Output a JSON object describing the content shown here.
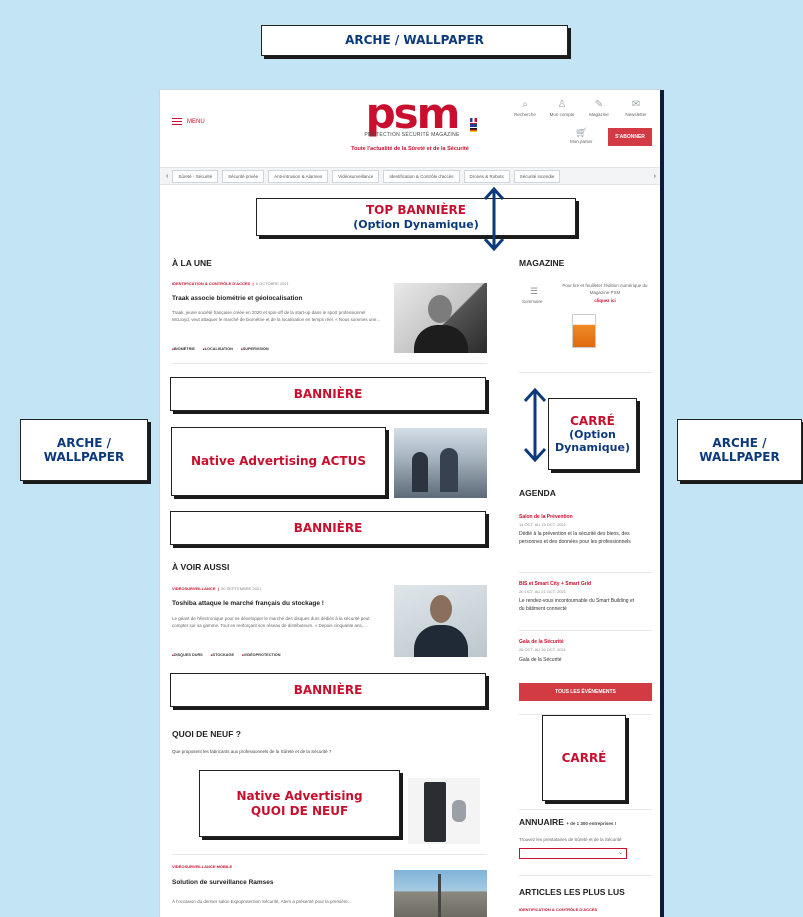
{
  "callouts": {
    "wallpaper_top": "ARCHE / WALLPAPER",
    "wallpaper_left": [
      "ARCHE /",
      "WALLPAPER"
    ],
    "wallpaper_right": [
      "ARCHE /",
      "WALLPAPER"
    ],
    "top_banner": [
      "TOP BANNIÈRE",
      "(Option Dynamique)"
    ],
    "banniere": "BANNIÈRE",
    "native_actus": "Native Advertising ACTUS",
    "native_quoi": [
      "Native Advertising",
      "QUOI DE NEUF"
    ],
    "carre_dyn": [
      "CARRÉ",
      "(Option",
      "Dynamique)"
    ],
    "carre": "CARRÉ"
  },
  "header": {
    "menu_label": "MENU",
    "logo": "psm",
    "logo_sub": "PROTECTION SÉCURITÉ MAGAZINE",
    "tagline": "Toute l'actualité de la Sûreté et de la Sécurité",
    "icons": [
      {
        "icon": "search-icon",
        "glyph": "⌕",
        "label": "Recherche"
      },
      {
        "icon": "user-icon",
        "glyph": "♙",
        "label": "Mon compte"
      },
      {
        "icon": "magazine-icon",
        "glyph": "✎",
        "label": "Magazine"
      },
      {
        "icon": "newsletter-icon",
        "glyph": "✉",
        "label": "Newsletter"
      }
    ],
    "cart_label": "Mon panier",
    "subscribe_label": "S'ABONNER"
  },
  "tabs": [
    "Sûreté - Sécurité",
    "Sécurité privée",
    "Anti-intrusion & Alarmes",
    "Vidéosurveillance",
    "Identification & Contrôle d'accès",
    "Drones & Robots",
    "Sécurité incendie"
  ],
  "a_la_une": {
    "title": "À LA UNE",
    "category": "IDENTIFICATION & CONTRÔLE D'ACCÈS",
    "date": "6 OCTOBRE 2021",
    "headline": "Traak associe biométrie et géolocalisation",
    "excerpt": "Traak, jeune société française créée en 2020 et spin-off de la start-up dans le sport professionnel McLloyd, veut attaquer le marché de biométrie et de la localisation en temps réel. « Nous sommes une...",
    "tags": [
      "BIOMÉTRIE",
      "LOCALISATION",
      "SUPERVISION"
    ]
  },
  "a_voir": {
    "title": "À VOIR AUSSI",
    "category": "VIDÉOSURVEILLANCE",
    "date": "30 SEPTEMBRE 2021",
    "headline": "Toshiba attaque le marché français du stockage !",
    "excerpt": "Le géant de l'électronique pour se développer le marché des disques durs dédiés à la sécurité peut compter sur sa gamme. Tout en renforçant son réseau de distributeurs. « Depuis cinquante ans,...",
    "tags": [
      "DISQUES DURS",
      "STOCKAGE",
      "VIDÉOPROTECTION"
    ]
  },
  "quoi_de_neuf": {
    "title": "QUOI DE NEUF ?",
    "subtitle": "Que proposent les fabricants aux professionnels de la Sûreté et de la Sécurité ?",
    "category": "VIDÉOSURVEILLANCE MOBILE",
    "headline": "Solution de surveillance Ramses",
    "excerpt": "À l'occasion du dernier salon Expoprotection Sécurité, Atem a présenté pour la première..."
  },
  "sidebar": {
    "magazine_title": "MAGAZINE",
    "magazine_text": "Pour lire et feuilleter l'édition numérique du Magazine PSM",
    "magazine_link": "cliquez ici",
    "sommaire": "Sommaire",
    "agenda_title": "AGENDA",
    "events": [
      {
        "name": "Salon de la Prévention",
        "date": "14 OCT. AU 15 OCT. 2021",
        "desc": "Dédié à la prévention et la sécurité des biens, des personnes et des données pour les professionnels"
      },
      {
        "name": "BIS et Smart City + Smart Grid",
        "date": "20 OCT. AU 21 OCT. 2021",
        "desc": "Le rendez-vous incontournable du Smart Building et du bâtiment connecté"
      },
      {
        "name": "Gala de la Sécurité",
        "date": "26 OCT. AU 26 OCT. 2021",
        "desc": "Gala de la Sécurité"
      }
    ],
    "events_button": "TOUS LES ÉVÈNEMENTS",
    "annuaire_title": "ANNUAIRE",
    "annuaire_count": "+ de 1 300 entreprises !",
    "annuaire_text": "Trouvez les prestataires de Sûreté et de la Sécurité",
    "plus_lus_title": "ARTICLES LES PLUS LUS",
    "plus_lus_cat": "IDENTIFICATION & CONTRÔLE D'ACCÈS"
  }
}
